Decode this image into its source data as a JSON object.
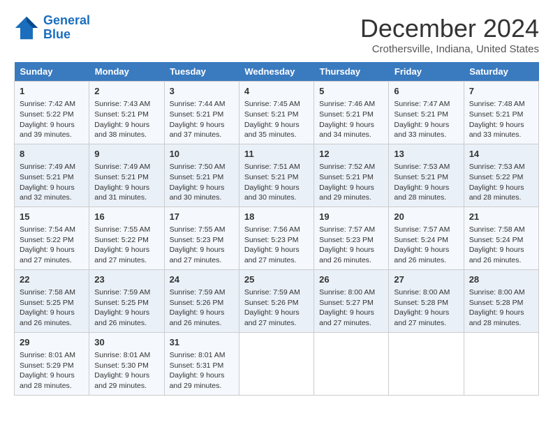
{
  "logo": {
    "line1": "General",
    "line2": "Blue"
  },
  "title": "December 2024",
  "subtitle": "Crothersville, Indiana, United States",
  "days_header": [
    "Sunday",
    "Monday",
    "Tuesday",
    "Wednesday",
    "Thursday",
    "Friday",
    "Saturday"
  ],
  "weeks": [
    [
      {
        "num": "1",
        "sunrise": "Sunrise: 7:42 AM",
        "sunset": "Sunset: 5:22 PM",
        "daylight": "Daylight: 9 hours and 39 minutes."
      },
      {
        "num": "2",
        "sunrise": "Sunrise: 7:43 AM",
        "sunset": "Sunset: 5:21 PM",
        "daylight": "Daylight: 9 hours and 38 minutes."
      },
      {
        "num": "3",
        "sunrise": "Sunrise: 7:44 AM",
        "sunset": "Sunset: 5:21 PM",
        "daylight": "Daylight: 9 hours and 37 minutes."
      },
      {
        "num": "4",
        "sunrise": "Sunrise: 7:45 AM",
        "sunset": "Sunset: 5:21 PM",
        "daylight": "Daylight: 9 hours and 35 minutes."
      },
      {
        "num": "5",
        "sunrise": "Sunrise: 7:46 AM",
        "sunset": "Sunset: 5:21 PM",
        "daylight": "Daylight: 9 hours and 34 minutes."
      },
      {
        "num": "6",
        "sunrise": "Sunrise: 7:47 AM",
        "sunset": "Sunset: 5:21 PM",
        "daylight": "Daylight: 9 hours and 33 minutes."
      },
      {
        "num": "7",
        "sunrise": "Sunrise: 7:48 AM",
        "sunset": "Sunset: 5:21 PM",
        "daylight": "Daylight: 9 hours and 33 minutes."
      }
    ],
    [
      {
        "num": "8",
        "sunrise": "Sunrise: 7:49 AM",
        "sunset": "Sunset: 5:21 PM",
        "daylight": "Daylight: 9 hours and 32 minutes."
      },
      {
        "num": "9",
        "sunrise": "Sunrise: 7:49 AM",
        "sunset": "Sunset: 5:21 PM",
        "daylight": "Daylight: 9 hours and 31 minutes."
      },
      {
        "num": "10",
        "sunrise": "Sunrise: 7:50 AM",
        "sunset": "Sunset: 5:21 PM",
        "daylight": "Daylight: 9 hours and 30 minutes."
      },
      {
        "num": "11",
        "sunrise": "Sunrise: 7:51 AM",
        "sunset": "Sunset: 5:21 PM",
        "daylight": "Daylight: 9 hours and 30 minutes."
      },
      {
        "num": "12",
        "sunrise": "Sunrise: 7:52 AM",
        "sunset": "Sunset: 5:21 PM",
        "daylight": "Daylight: 9 hours and 29 minutes."
      },
      {
        "num": "13",
        "sunrise": "Sunrise: 7:53 AM",
        "sunset": "Sunset: 5:21 PM",
        "daylight": "Daylight: 9 hours and 28 minutes."
      },
      {
        "num": "14",
        "sunrise": "Sunrise: 7:53 AM",
        "sunset": "Sunset: 5:22 PM",
        "daylight": "Daylight: 9 hours and 28 minutes."
      }
    ],
    [
      {
        "num": "15",
        "sunrise": "Sunrise: 7:54 AM",
        "sunset": "Sunset: 5:22 PM",
        "daylight": "Daylight: 9 hours and 27 minutes."
      },
      {
        "num": "16",
        "sunrise": "Sunrise: 7:55 AM",
        "sunset": "Sunset: 5:22 PM",
        "daylight": "Daylight: 9 hours and 27 minutes."
      },
      {
        "num": "17",
        "sunrise": "Sunrise: 7:55 AM",
        "sunset": "Sunset: 5:23 PM",
        "daylight": "Daylight: 9 hours and 27 minutes."
      },
      {
        "num": "18",
        "sunrise": "Sunrise: 7:56 AM",
        "sunset": "Sunset: 5:23 PM",
        "daylight": "Daylight: 9 hours and 27 minutes."
      },
      {
        "num": "19",
        "sunrise": "Sunrise: 7:57 AM",
        "sunset": "Sunset: 5:23 PM",
        "daylight": "Daylight: 9 hours and 26 minutes."
      },
      {
        "num": "20",
        "sunrise": "Sunrise: 7:57 AM",
        "sunset": "Sunset: 5:24 PM",
        "daylight": "Daylight: 9 hours and 26 minutes."
      },
      {
        "num": "21",
        "sunrise": "Sunrise: 7:58 AM",
        "sunset": "Sunset: 5:24 PM",
        "daylight": "Daylight: 9 hours and 26 minutes."
      }
    ],
    [
      {
        "num": "22",
        "sunrise": "Sunrise: 7:58 AM",
        "sunset": "Sunset: 5:25 PM",
        "daylight": "Daylight: 9 hours and 26 minutes."
      },
      {
        "num": "23",
        "sunrise": "Sunrise: 7:59 AM",
        "sunset": "Sunset: 5:25 PM",
        "daylight": "Daylight: 9 hours and 26 minutes."
      },
      {
        "num": "24",
        "sunrise": "Sunrise: 7:59 AM",
        "sunset": "Sunset: 5:26 PM",
        "daylight": "Daylight: 9 hours and 26 minutes."
      },
      {
        "num": "25",
        "sunrise": "Sunrise: 7:59 AM",
        "sunset": "Sunset: 5:26 PM",
        "daylight": "Daylight: 9 hours and 27 minutes."
      },
      {
        "num": "26",
        "sunrise": "Sunrise: 8:00 AM",
        "sunset": "Sunset: 5:27 PM",
        "daylight": "Daylight: 9 hours and 27 minutes."
      },
      {
        "num": "27",
        "sunrise": "Sunrise: 8:00 AM",
        "sunset": "Sunset: 5:28 PM",
        "daylight": "Daylight: 9 hours and 27 minutes."
      },
      {
        "num": "28",
        "sunrise": "Sunrise: 8:00 AM",
        "sunset": "Sunset: 5:28 PM",
        "daylight": "Daylight: 9 hours and 28 minutes."
      }
    ],
    [
      {
        "num": "29",
        "sunrise": "Sunrise: 8:01 AM",
        "sunset": "Sunset: 5:29 PM",
        "daylight": "Daylight: 9 hours and 28 minutes."
      },
      {
        "num": "30",
        "sunrise": "Sunrise: 8:01 AM",
        "sunset": "Sunset: 5:30 PM",
        "daylight": "Daylight: 9 hours and 29 minutes."
      },
      {
        "num": "31",
        "sunrise": "Sunrise: 8:01 AM",
        "sunset": "Sunset: 5:31 PM",
        "daylight": "Daylight: 9 hours and 29 minutes."
      },
      null,
      null,
      null,
      null
    ]
  ]
}
